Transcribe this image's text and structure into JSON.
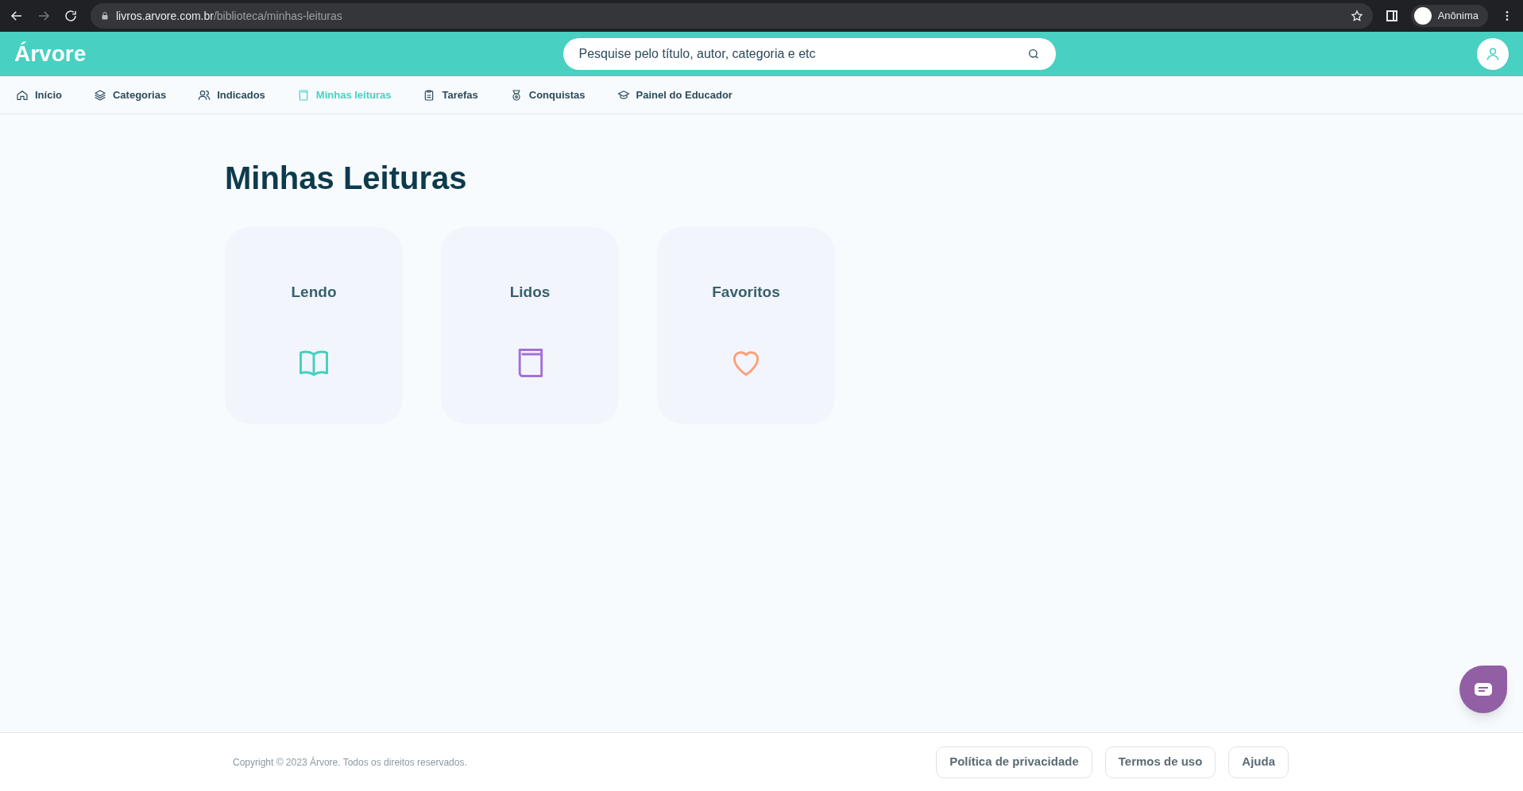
{
  "browser": {
    "url_host": "livros.arvore.com.br",
    "url_path": "/biblioteca/minhas-leituras",
    "profile": "Anônima"
  },
  "header": {
    "logo": "Árvore",
    "search": {
      "placeholder": "Pesquise pelo título, autor, categoria e etc"
    }
  },
  "nav": [
    {
      "label": "Início",
      "kind": "home",
      "selected": false
    },
    {
      "label": "Categorias",
      "kind": "categories",
      "selected": false
    },
    {
      "label": "Indicados",
      "kind": "recommended",
      "selected": false
    },
    {
      "label": "Minhas leituras",
      "kind": "readings",
      "selected": true
    },
    {
      "label": "Tarefas",
      "kind": "tasks",
      "selected": false
    },
    {
      "label": "Conquistas",
      "kind": "achievements",
      "selected": false
    },
    {
      "label": "Painel do Educador",
      "kind": "educator",
      "selected": false
    }
  ],
  "page_title": "Minhas Leituras",
  "cards": [
    {
      "label": "Lendo",
      "kind": "reading",
      "color": "#45cfc0"
    },
    {
      "label": "Lidos",
      "kind": "read",
      "color": "#a66fd9"
    },
    {
      "label": "Favoritos",
      "kind": "favorites",
      "color": "#fe9f78"
    }
  ],
  "footer": {
    "copyright": "Copyright © 2023 Árvore. Todos os direitos reservados.",
    "links": [
      "Política de privacidade",
      "Termos de uso",
      "Ajuda"
    ]
  }
}
